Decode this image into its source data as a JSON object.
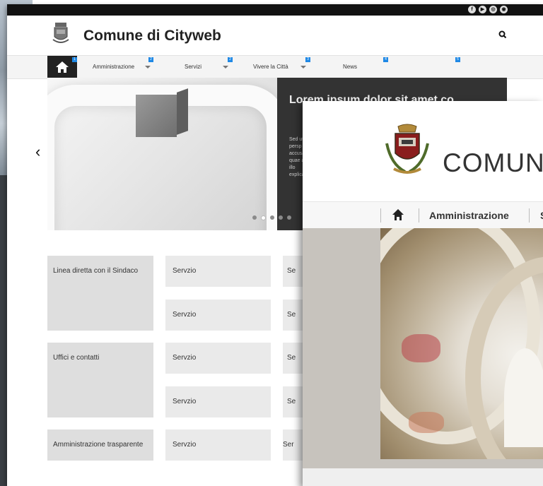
{
  "front_window": {
    "site_title": "Comune di Cityweb",
    "social_icons": [
      "facebook-icon",
      "youtube-icon",
      "instagram-icon",
      "rss-icon"
    ],
    "nav": {
      "items": [
        {
          "label": "Amministrazione",
          "badge": "2",
          "caret": true
        },
        {
          "label": "Servizi",
          "badge": "2",
          "caret": true
        },
        {
          "label": "Vivere la Città",
          "badge": "3",
          "caret": true
        },
        {
          "label": "News",
          "badge": "4",
          "caret": false
        },
        {
          "label": "",
          "badge": "5",
          "caret": false
        }
      ],
      "home_badge": "1"
    },
    "slider": {
      "title": "Lorem ipsum dolor sit amet co",
      "text": "Sed ut persp accusantium quae ab illo explicabo.",
      "dots": 5,
      "active_dot": 1
    },
    "tiles": {
      "left": [
        "Linea diretta con il Sindaco",
        "Uffici e contatti",
        "Amministrazione trasparente"
      ],
      "services": [
        "Servzio",
        "Servzio",
        "Servzio",
        "Servzio",
        "Servzio"
      ],
      "partial": [
        "Se",
        "Se",
        "Se",
        "Se",
        "Ser"
      ]
    }
  },
  "back_window": {
    "title": "COMUN",
    "nav_label": "Amministrazione",
    "nav_partial": "S"
  },
  "colors": {
    "topbar": "#111111",
    "slider_dark": "#333333",
    "badge": "#1e88e5",
    "tile": "#dedede"
  }
}
